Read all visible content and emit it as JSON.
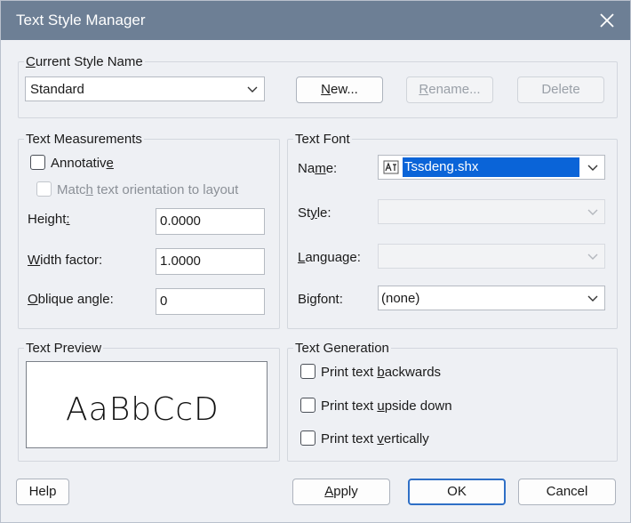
{
  "window": {
    "title": "Text Style Manager"
  },
  "current_style": {
    "group_label_underline": "C",
    "group_label_rest": "urrent Style Name",
    "selected_style": "Standard",
    "new_btn": {
      "ul": "N",
      "rest": "ew..."
    },
    "rename_btn": {
      "ul": "R",
      "rest": "ename..."
    },
    "delete_btn": "Delete"
  },
  "measurements": {
    "group_label": "Text Measurements",
    "annotative": {
      "pre": "Annotativ",
      "ul": "e",
      "post": "",
      "checked": false
    },
    "match_orientation": {
      "pre": "Matc",
      "ul": "h",
      "post": " text orientation to layout",
      "checked": false
    },
    "height": {
      "pre": "Height",
      "ul": ":",
      "post": "",
      "value": "0.0000"
    },
    "width_factor": {
      "ul": "W",
      "post": "idth factor:",
      "value": "1.0000"
    },
    "oblique_angle": {
      "ul": "O",
      "post": "blique angle:",
      "value": "0"
    }
  },
  "font": {
    "group_label": "Text Font",
    "name": {
      "pre": "Na",
      "ul": "m",
      "post": "e:",
      "value": "Tssdeng.shx"
    },
    "style": {
      "pre": "St",
      "ul": "y",
      "post": "le:"
    },
    "language": {
      "ul": "L",
      "post": "anguage:"
    },
    "bigfont": {
      "pre": "Bi",
      "ul": "g",
      "post": "font:",
      "value": "(none)"
    }
  },
  "preview": {
    "group_label": "Text Preview",
    "sample": "AaBbCcD"
  },
  "generation": {
    "group_label": "Text Generation",
    "backwards": {
      "pre": "Print text ",
      "ul": "b",
      "post": "ackwards",
      "checked": false
    },
    "upside_down": {
      "pre": "Print text ",
      "ul": "u",
      "post": "pside down",
      "checked": false
    },
    "vertically": {
      "pre": "Print text ",
      "ul": "v",
      "post": "ertically",
      "checked": false
    }
  },
  "footer": {
    "help": "Help",
    "apply": {
      "ul": "A",
      "rest": "pply"
    },
    "ok": "OK",
    "cancel": "Cancel"
  },
  "colors": {
    "titlebar": "#6d7f95",
    "selection": "#0a64d8",
    "accent_border": "#2f6fc6"
  }
}
